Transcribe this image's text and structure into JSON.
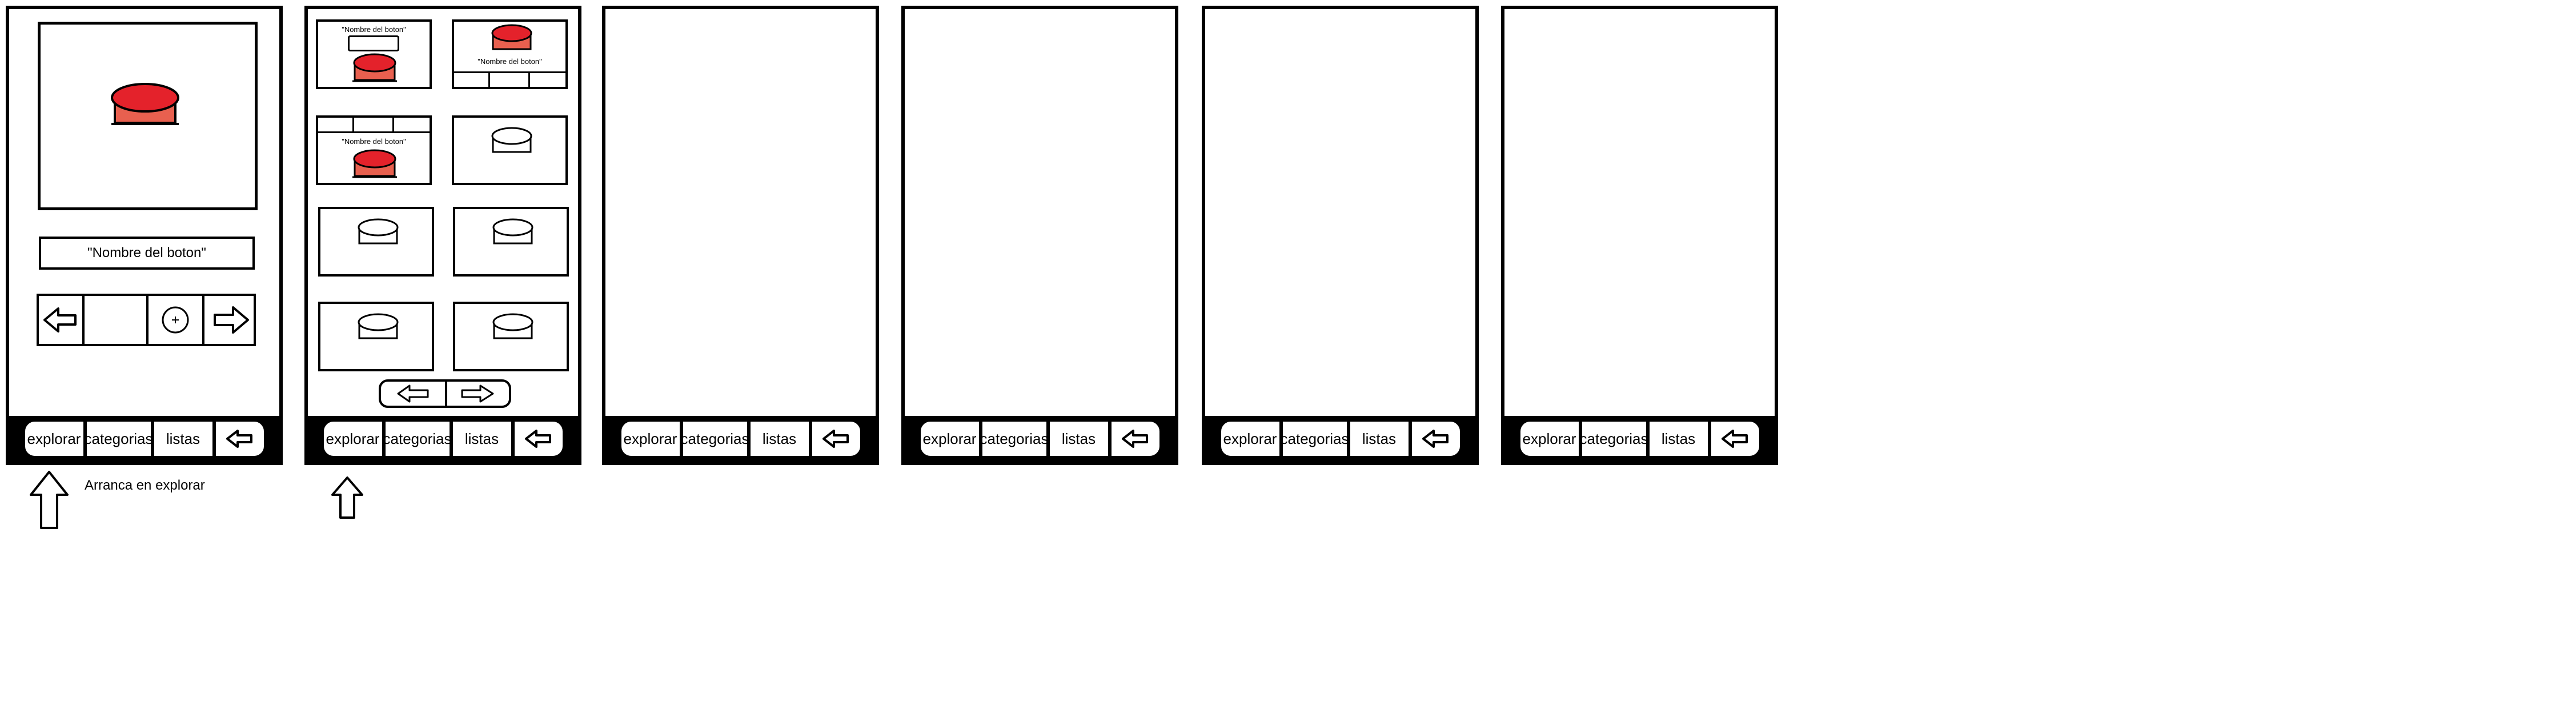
{
  "nav": {
    "explore": "explorar",
    "categories": "categorias",
    "lists": "listas"
  },
  "screen1": {
    "button_name": "\"Nombre del boton\""
  },
  "screen2": {
    "small_button_name": "\"Nombre del boton\""
  },
  "annotation": {
    "start_note": "Arranca en explorar"
  },
  "colors": {
    "button_red": "#e4222b",
    "button_base": "#e8604f"
  },
  "icons": {
    "back": "arrow-left-icon",
    "forward": "arrow-right-icon",
    "add": "plus-circle-icon",
    "indicator": "arrow-up-icon"
  }
}
